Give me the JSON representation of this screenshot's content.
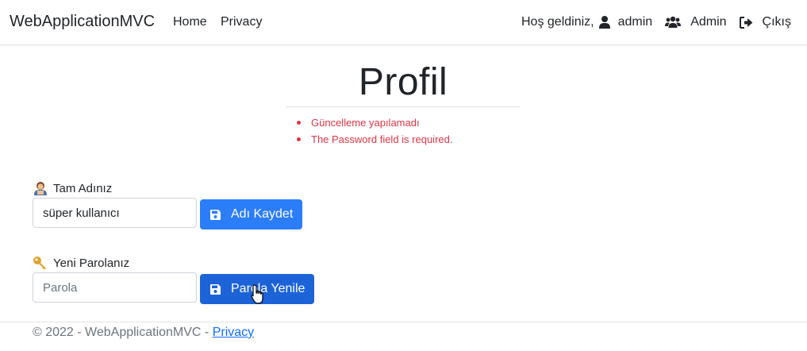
{
  "navbar": {
    "brand": "WebApplicationMVC",
    "links": [
      "Home",
      "Privacy"
    ],
    "welcome": "Hoş geldiniz,",
    "user": "admin",
    "admin_link": "Admin",
    "logout": "Çıkış",
    "icons": [
      "user-icon",
      "users-icon",
      "sign-out-icon"
    ]
  },
  "page": {
    "title": "Profil",
    "errors": [
      "Güncelleme yapılamadı",
      "The Password field is required."
    ]
  },
  "name_form": {
    "label": "Tam Adınız",
    "value": "süper kullanıcı",
    "button": "Adı Kaydet"
  },
  "password_form": {
    "label": "Yeni Parolanız",
    "placeholder": "Parola",
    "button": "Parola Yenile"
  },
  "footer": {
    "text": "© 2022 - WebApplicationMVC - ",
    "link": "Privacy"
  },
  "colors": {
    "primary": "#2b7dfa",
    "primary_active": "#1d63d8",
    "error": "#dc3545",
    "link": "#0d6efd"
  }
}
